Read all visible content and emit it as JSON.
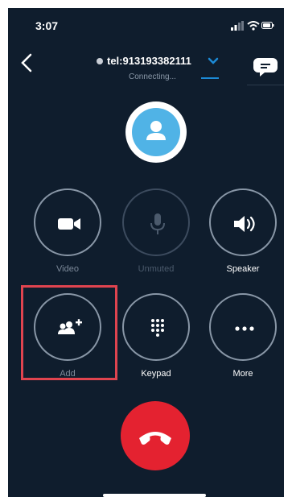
{
  "status_bar": {
    "time": "3:07",
    "icons": [
      "signal-icon",
      "wifi-icon",
      "battery-icon"
    ]
  },
  "header": {
    "back_icon": "chevron-left-icon",
    "callee": "tel:913193382111",
    "status": "Connecting...",
    "chat_icon": "chat-bubble-icon"
  },
  "avatar": {
    "icon": "person-icon"
  },
  "controls": {
    "video": {
      "label": "Video",
      "icon": "video-camera-icon"
    },
    "unmute": {
      "label": "Unmuted",
      "icon": "microphone-icon"
    },
    "speaker": {
      "label": "Speaker",
      "icon": "speaker-icon"
    },
    "add": {
      "label": "Add",
      "icon": "add-people-icon"
    },
    "keypad": {
      "label": "Keypad",
      "icon": "keypad-icon"
    },
    "more": {
      "label": "More",
      "icon": "more-dots-icon"
    }
  },
  "end_call": {
    "icon": "hang-up-icon"
  },
  "colors": {
    "background": "#0f1d2d",
    "accent": "#1c8ad6",
    "avatar": "#50b3e6",
    "end_call": "#e42230",
    "highlight": "#e0444f"
  }
}
